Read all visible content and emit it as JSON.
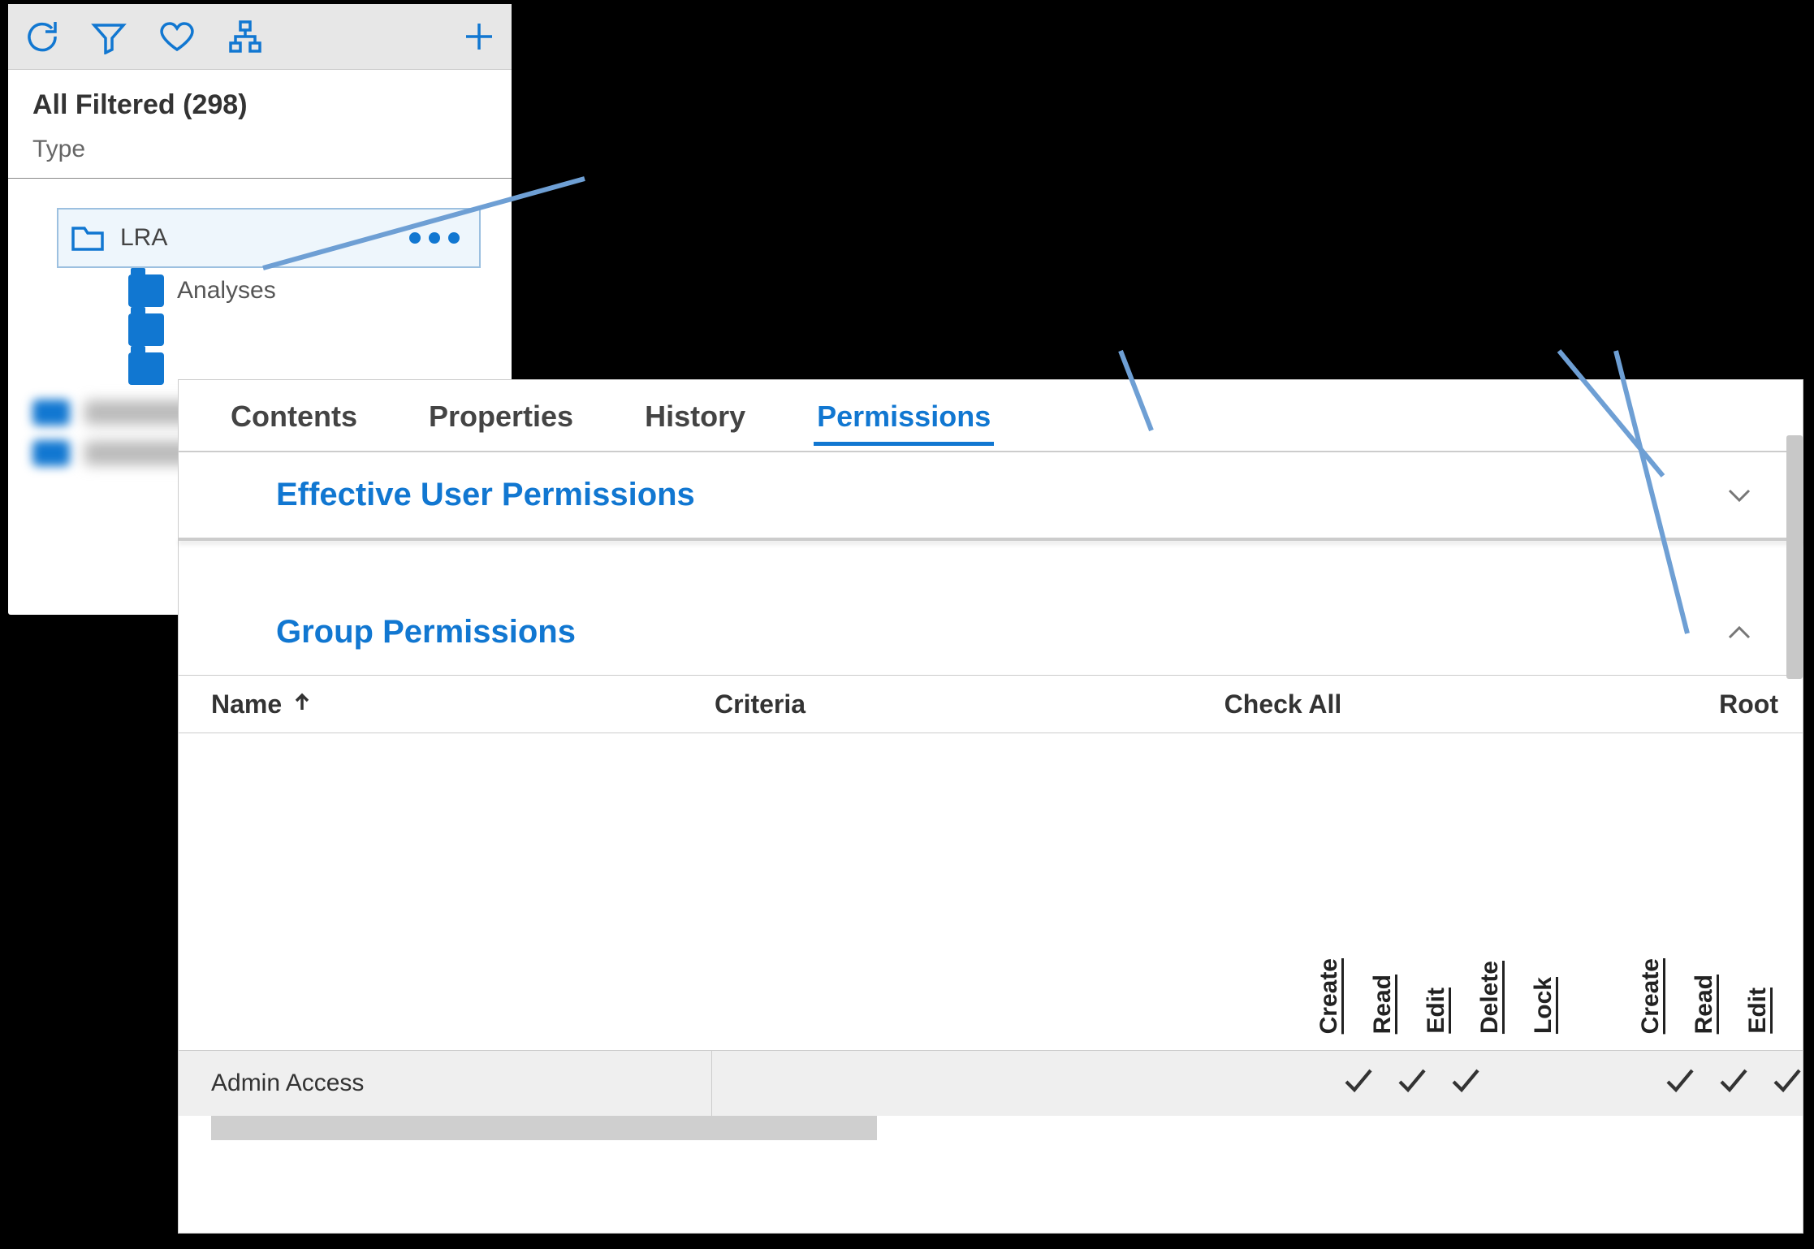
{
  "sidebar": {
    "title": "All Filtered (298)",
    "type_label": "Type",
    "selected": {
      "label": "LRA"
    },
    "children": [
      {
        "label": "Analyses"
      }
    ]
  },
  "tabs": [
    {
      "label": "Contents",
      "active": false
    },
    {
      "label": "Properties",
      "active": false
    },
    {
      "label": "History",
      "active": false
    },
    {
      "label": "Permissions",
      "active": true
    }
  ],
  "sections": {
    "effective": {
      "title": "Effective User Permissions"
    },
    "group": {
      "title": "Group Permissions"
    }
  },
  "table": {
    "cols": {
      "name": "Name",
      "criteria": "Criteria",
      "check_all": "Check All",
      "root": "Root"
    },
    "check_all_perms": [
      "Create",
      "Read",
      "Edit",
      "Delete",
      "Lock"
    ],
    "root_perms": [
      "Create",
      "Read",
      "Edit"
    ],
    "rows": [
      {
        "name": "Admin Access",
        "criteria": "",
        "check_all": {
          "Create": true,
          "Read": true,
          "Edit": true,
          "Delete": false,
          "Lock": false
        },
        "root": {
          "Create": true,
          "Read": true,
          "Edit": true
        }
      }
    ]
  }
}
